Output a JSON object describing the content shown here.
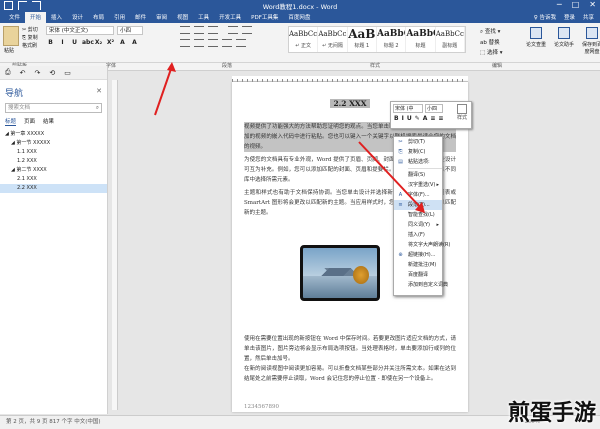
{
  "window": {
    "title": "Word教程1.docx - Word",
    "controls": [
      "─",
      "□",
      "✕"
    ]
  },
  "ribbon_tabs": {
    "items": [
      "文件",
      "开始",
      "插入",
      "设计",
      "布局",
      "引用",
      "邮件",
      "审阅",
      "视图",
      "工具",
      "开发工具",
      "PDF工具集",
      "百度网盘"
    ],
    "active_index": 1,
    "right": [
      "♀ 告诉我",
      "登录",
      "共享"
    ]
  },
  "clipboard": {
    "paste_label": "粘贴",
    "cut": "✂ 剪切",
    "copy": "⎘ 复制",
    "painter": "格式刷",
    "group": "剪贴板"
  },
  "font": {
    "name": "宋体 (中文正文)",
    "size": "小四",
    "group": "字体",
    "buttons": [
      "B",
      "I",
      "U",
      "abc",
      "X₂",
      "X²",
      "A",
      "A"
    ]
  },
  "paragraph": {
    "group": "段落"
  },
  "styles": {
    "group": "样式",
    "items": [
      {
        "preview": "AaBbCcDc",
        "name": "↵ 正文",
        "size": "normal"
      },
      {
        "preview": "AaBbCcDc",
        "name": "↵ 无间隔",
        "size": "normal"
      },
      {
        "preview": "AaB",
        "name": "标题 1",
        "size": "big"
      },
      {
        "preview": "AaBbC",
        "name": "标题 2",
        "size": "mid"
      },
      {
        "preview": "AaBbC",
        "name": "标题",
        "size": "mid"
      },
      {
        "preview": "AaBbCc",
        "name": "副标题",
        "size": "normal"
      }
    ]
  },
  "editing": {
    "find": "⌕ 查找 ▾",
    "replace": "ab 替换",
    "select": "⬚ 选择 ▾",
    "group": "编辑"
  },
  "big_buttons": [
    {
      "label": "论文查重"
    },
    {
      "label": "论文助手"
    },
    {
      "label": "保存到百度网盘"
    }
  ],
  "nav": {
    "toolbar": [
      "⎙",
      "↶",
      "↷",
      "⟲",
      "▭"
    ],
    "title": "导航",
    "close": "✕",
    "search_placeholder": "搜索文档",
    "tabs": [
      "标题",
      "页面",
      "结果"
    ],
    "active_tab": 0,
    "tree": [
      {
        "label": "◢ 第一章 XXXXX",
        "level": 0
      },
      {
        "label": "◢ 第一节 XXXXX",
        "level": 1
      },
      {
        "label": "1.1 XXX",
        "level": 2
      },
      {
        "label": "1.2 XXX",
        "level": 2
      },
      {
        "label": "◢ 第二节 XXXX",
        "level": 1
      },
      {
        "label": "2.1 XXX",
        "level": 2
      },
      {
        "label": "2.2 XXX",
        "level": 2,
        "selected": true
      }
    ]
  },
  "document": {
    "heading": "2.2 XXX",
    "p1": "视频提供了功能强大的方法帮助您证明您的观点。当您单击联机视频时，可以在想要添加的视频的嵌入代码中进行粘贴。您也可以键入一个关键字以联机搜索最适合您的文档的视频。",
    "p2": "为使您的文档具有专业外观，Word 提供了页眉、页脚、封面和文本框设计，这些设计可互为补充。例如，您可以添加匹配的封面、页眉和提要栏。单击“插入”，然后从不同库中选择所需元素。",
    "p3": "主题和样式也有助于文档保持协调。当您单击设计并选择新的主题时，图片、图表或 SmartArt 图形将会更改以匹配新的主题。当应用样式时，您的标题会进行更改以匹配新的主题。",
    "p4": "使用在需要位置出现的新按钮在 Word 中保存时间。若要更改图片适应文档的方式，请单击该图片，图片旁边将会显示布局选项按钮。当处理表格时，单击要添加行或列的位置，然后单击加号。",
    "p5": "在新的阅读视图中阅读更加容易。可以折叠文档某些部分并关注所需文本。如果在达到结尾处之前需要停止读取，Word 会记住您的停止位置 - 即使在另一个设备上。",
    "footer_text": "1234567890"
  },
  "mini_toolbar": {
    "font": "宋体 (中",
    "size": "小四",
    "style_label": "样式",
    "buttons": [
      "B",
      "I",
      "U",
      "✎",
      "A",
      "≡",
      "≡"
    ]
  },
  "context_menu": {
    "items": [
      {
        "icon": "✂",
        "label": "剪切(T)"
      },
      {
        "icon": "⎘",
        "label": "复制(C)"
      },
      {
        "icon": "▤",
        "label": "粘贴选项:"
      },
      {
        "icon": "",
        "label": "",
        "sep": true
      },
      {
        "icon": "",
        "label": "翻译(S)"
      },
      {
        "icon": "",
        "label": "汉字重选(V)",
        "submenu": true
      },
      {
        "icon": "A",
        "label": "字体(F)..."
      },
      {
        "icon": "≡",
        "label": "段落(P)...",
        "hover": true
      },
      {
        "icon": "",
        "label": "智能查找(L)"
      },
      {
        "icon": "",
        "label": "同义词(Y)",
        "submenu": true
      },
      {
        "icon": "",
        "label": "插入(F)"
      },
      {
        "icon": "",
        "label": "将文字大声朗读(R)"
      },
      {
        "icon": "⊕",
        "label": "超链接(H)..."
      },
      {
        "icon": "",
        "label": "新建批注(M)"
      },
      {
        "icon": "",
        "label": "百度翻译"
      },
      {
        "icon": "",
        "label": "添加到自定义词典"
      }
    ]
  },
  "status": {
    "text": "第 2 页，共 9 页    817 个字    中文(中国)",
    "zoom": "100%"
  },
  "watermark": "煎蛋手游"
}
